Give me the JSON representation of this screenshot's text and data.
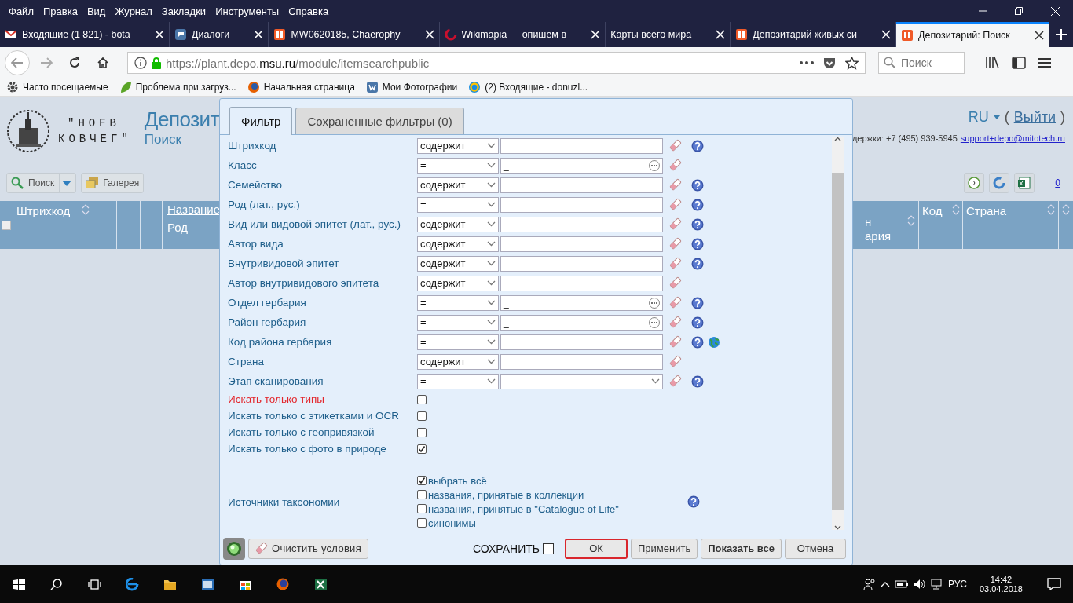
{
  "menu_bar": [
    "Файл",
    "Правка",
    "Вид",
    "Журнал",
    "Закладки",
    "Инструменты",
    "Справка"
  ],
  "tabs": [
    {
      "label": "Входящие (1 821) - bota",
      "kind": "mail",
      "selected": false
    },
    {
      "label": "Диалоги",
      "kind": "chat",
      "selected": false
    },
    {
      "label": "MW0620185, Chaerophy",
      "kind": "depo",
      "selected": false
    },
    {
      "label": "Wikimapia — опишем в",
      "kind": "map",
      "selected": false
    },
    {
      "label": "Карты всего мира",
      "kind": "plain",
      "selected": false
    },
    {
      "label": "Депозитарий живых си",
      "kind": "depo",
      "selected": false
    },
    {
      "label": "Депозитарий: Поиск",
      "kind": "depo",
      "selected": true
    }
  ],
  "address_bar": {
    "url": [
      {
        "text": "https://plant.depo.",
        "emphasis": false
      },
      {
        "text": "msu.ru",
        "emphasis": true
      },
      {
        "text": "/module/itemsearchpublic",
        "emphasis": false
      }
    ]
  },
  "search_box": {
    "placeholder": "Поиск"
  },
  "bookmarks": [
    {
      "label": "Часто посещаемые",
      "kind": "gear"
    },
    {
      "label": "Проблема при загруз...",
      "kind": "leaf"
    },
    {
      "label": "Начальная страница",
      "kind": "browser"
    },
    {
      "label": "Мои Фотографии",
      "kind": "social"
    },
    {
      "label": "(2) Входящие - donuzl...",
      "kind": "mail"
    }
  ],
  "page": {
    "logo_lines": [
      "\"НОЕВ",
      "КОВЧЕГ\""
    ],
    "title": "Депозит",
    "subtitle": "Поиск",
    "language": "RU",
    "logout": {
      "before": "(",
      "link": "Выйти",
      "after": ")"
    },
    "support_text": "держки: +7 (495) 939-5945",
    "support_email": "support+depo@mitotech.ru",
    "search_button": "Поиск",
    "gallery_button": "Галерея",
    "count_link": "0",
    "select_all_checked": false,
    "left_columns": [
      {
        "label": "Штрихкод",
        "kind": "sortable"
      },
      {
        "kind": "blank"
      },
      {
        "kind": "blank"
      },
      {
        "kind": "blank"
      }
    ],
    "name_column": {
      "label": "Название",
      "sub": "Род"
    },
    "right_columns": [
      {
        "lines": [
          "н",
          "ария"
        ]
      },
      {
        "lines": [
          "Код"
        ]
      },
      {
        "lines": [
          "Страна"
        ]
      }
    ]
  },
  "dialog": {
    "tabs": [
      {
        "label": "Фильтр",
        "selected": true
      },
      {
        "label": "Сохраненные фильтры (0)",
        "selected": false
      }
    ],
    "filters": [
      {
        "label": "Штрихкод",
        "operator": "содержит",
        "kind": "text",
        "help": true,
        "map": false
      },
      {
        "label": "Класс",
        "operator": "=",
        "kind": "lookup",
        "value": "_",
        "help": false,
        "map": false
      },
      {
        "label": "Семейство",
        "operator": "содержит",
        "kind": "text",
        "help": true,
        "map": false
      },
      {
        "label": "Род (лат., рус.)",
        "operator": "=",
        "kind": "text",
        "help": true,
        "map": false
      },
      {
        "label": "Вид или видовой эпитет (лат., рус.)",
        "operator": "содержит",
        "kind": "text",
        "help": true,
        "map": false
      },
      {
        "label": "Автор вида",
        "operator": "содержит",
        "kind": "text",
        "help": true,
        "map": false
      },
      {
        "label": "Внутривидовой эпитет",
        "operator": "содержит",
        "kind": "text",
        "help": true,
        "map": false
      },
      {
        "label": "Автор внутривидового эпитета",
        "operator": "содержит",
        "kind": "text",
        "help": false,
        "map": false
      },
      {
        "label": "Отдел гербария",
        "operator": "=",
        "kind": "lookup",
        "value": "_",
        "help": true,
        "map": false
      },
      {
        "label": "Район гербария",
        "operator": "=",
        "kind": "lookup",
        "value": "_",
        "help": true,
        "map": false
      },
      {
        "label": "Код района гербария",
        "operator": "=",
        "kind": "text",
        "help": true,
        "map": true
      },
      {
        "label": "Страна",
        "operator": "содержит",
        "kind": "text",
        "help": false,
        "map": false
      },
      {
        "label": "Этап сканирования",
        "operator": "=",
        "kind": "select",
        "help": true,
        "map": false
      }
    ],
    "flags": [
      {
        "label": "Искать только типы",
        "checked": false,
        "emphasis": true
      },
      {
        "label": "Искать только с этикетками и OCR",
        "checked": false,
        "emphasis": false
      },
      {
        "label": "Искать только с геопривязкой",
        "checked": false,
        "emphasis": false
      },
      {
        "label": "Искать только с фото в природе",
        "checked": true,
        "emphasis": false
      }
    ],
    "taxonomy": {
      "label": "Источники таксономии",
      "help": true,
      "options": [
        {
          "label": "выбрать всё",
          "checked": true
        },
        {
          "label": "названия, принятые в коллекции",
          "checked": false
        },
        {
          "label": "названия, принятые в \"Catalogue of Life\"",
          "checked": false
        },
        {
          "label": "синонимы",
          "checked": false
        }
      ]
    },
    "footer": {
      "clear_button": "Очистить условия",
      "save_label": "СОХРАНИТЬ",
      "save_checked": false,
      "buttons": [
        {
          "label": "ОК",
          "kind": "focused"
        },
        {
          "label": "Применить",
          "kind": "normal"
        },
        {
          "label": "Показать все",
          "kind": "bold"
        },
        {
          "label": "Отмена",
          "kind": "normal"
        }
      ]
    }
  },
  "taskbar": {
    "language": "РУС",
    "time": "14:42",
    "date": "03.04.2018"
  }
}
